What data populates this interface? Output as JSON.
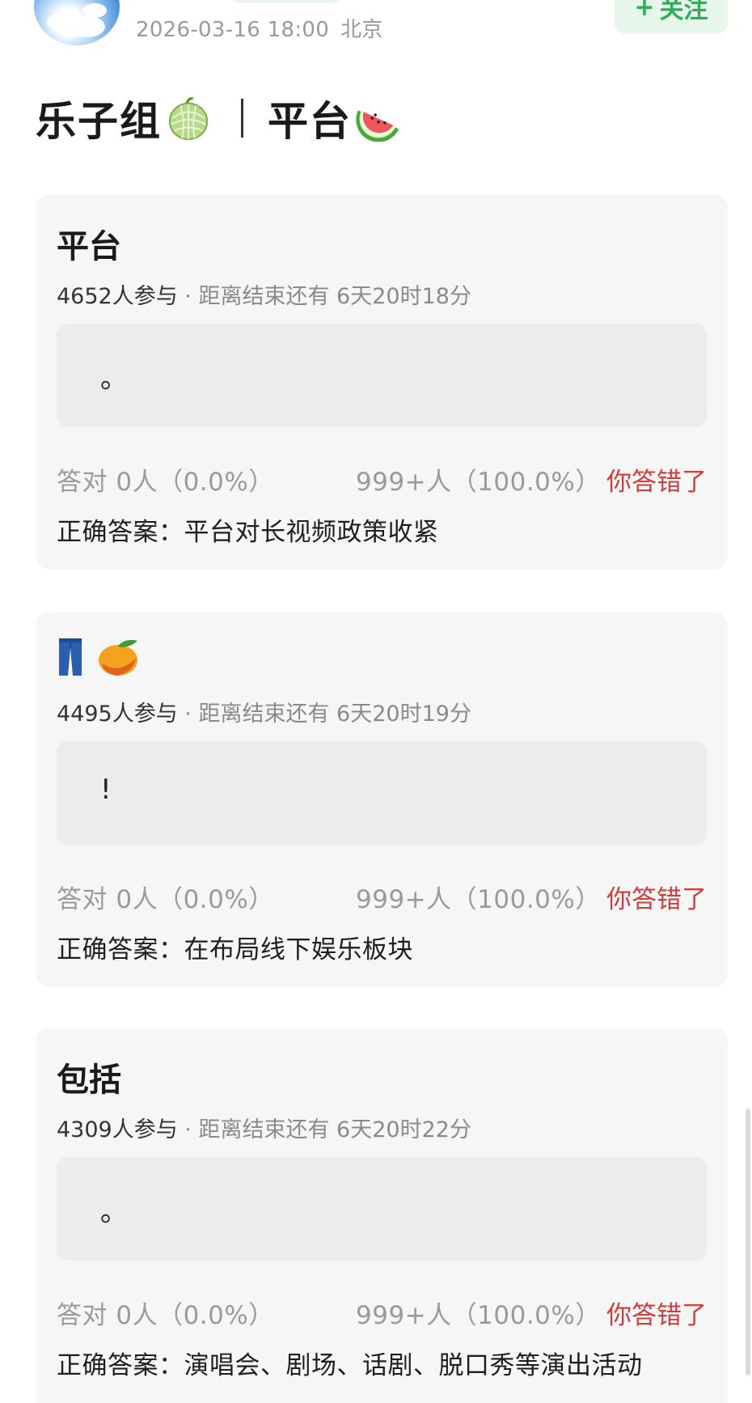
{
  "header": {
    "date": "2026-03-16 18:00",
    "location": "北京",
    "follow_plus": "+",
    "follow_label": "关注"
  },
  "title": {
    "part1": "乐子组",
    "part1_emoji": "melon-icon",
    "part2": "平台",
    "part2_emoji": "watermelon-icon"
  },
  "cards": [
    {
      "title": "平台",
      "participants": "4652人参与",
      "deadline": " · 距离结束还有 6天20时18分",
      "answer_mark": "。",
      "correct_count": "答对  0人（0.0%）",
      "wrong_count": "999+人（100.0%）",
      "verdict": "你答错了",
      "correct_answer": "正确答案：平台对长视频政策收紧"
    },
    {
      "icons": [
        "jeans-icon",
        "mango-icon"
      ],
      "participants": "4495人参与",
      "deadline": " · 距离结束还有 6天20时19分",
      "answer_mark": "!",
      "correct_count": "答对  0人（0.0%）",
      "wrong_count": "999+人（100.0%）",
      "verdict": "你答错了",
      "correct_answer": "正确答案：在布局线下娱乐板块"
    },
    {
      "title": "包括",
      "participants": "4309人参与",
      "deadline": " · 距离结束还有 6天20时22分",
      "answer_mark": "。",
      "correct_count": "答对  0人（0.0%）",
      "wrong_count": "999+人（100.0%）",
      "verdict": "你答错了",
      "correct_answer": "正确答案：演唱会、剧场、话剧、脱口秀等演出活动"
    }
  ],
  "colors": {
    "accent_green": "#2eae5b",
    "wrong_red": "#d23c3c",
    "card_bg": "#f6f6f6"
  }
}
